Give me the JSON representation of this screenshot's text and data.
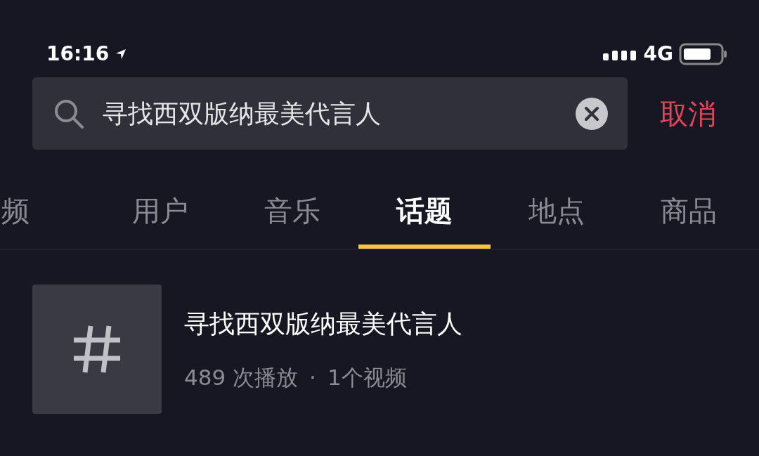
{
  "status_bar": {
    "time": "16:16",
    "network": "4G"
  },
  "search": {
    "value": "寻找西双版纳最美代言人",
    "cancel": "取消"
  },
  "tabs": [
    {
      "label": "频",
      "selected": false
    },
    {
      "label": "用户",
      "selected": false
    },
    {
      "label": "音乐",
      "selected": false
    },
    {
      "label": "话题",
      "selected": true
    },
    {
      "label": "地点",
      "selected": false
    },
    {
      "label": "商品",
      "selected": false
    }
  ],
  "results": [
    {
      "title": "寻找西双版纳最美代言人",
      "plays": "489 次播放",
      "separator": "·",
      "videos": "1个视频"
    }
  ]
}
